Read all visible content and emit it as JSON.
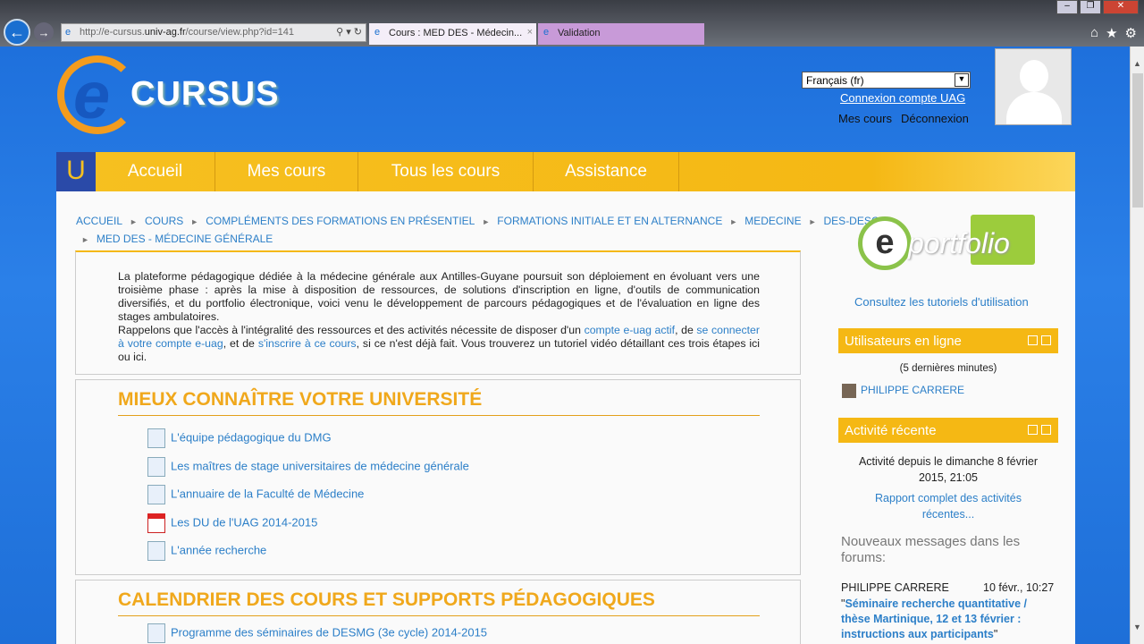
{
  "browser": {
    "url_prefix": "http://e-cursus.",
    "url_domain": "univ-ag.fr",
    "url_path": "/course/view.php?id=141",
    "tabs": [
      {
        "label": "Cours : MED DES - Médecin...",
        "active": true
      },
      {
        "label": "Validation",
        "active": false
      }
    ]
  },
  "header": {
    "logo_text": "CURSUS",
    "language": "Français (fr)",
    "login_link": "Connexion compte UAG",
    "my_courses": "Mes cours",
    "logout": "Déconnexion"
  },
  "menu": {
    "home": "Accueil",
    "mes_cours": "Mes cours",
    "tous": "Tous les cours",
    "assistance": "Assistance"
  },
  "breadcrumb": [
    "ACCUEIL",
    "COURS",
    "COMPLÉMENTS DES FORMATIONS EN PRÉSENTIEL",
    "FORMATIONS INITIALE ET EN ALTERNANCE",
    "MEDECINE",
    "DES-DESC",
    "MED DES - MÉDECINE GÉNÉRALE"
  ],
  "intro": {
    "p1": "La plateforme pédagogique dédiée à la médecine générale aux Antilles-Guyane poursuit son déploiement en évoluant vers une troisième phase : après la mise à disposition de ressources, de solutions d'inscription en ligne, d'outils de communication diversifiés, et du portfolio électronique,  voici venu le développement de parcours pédagogiques et de l'évaluation en ligne des stages ambulatoires.",
    "p2a": "Rappelons que l'accès à l'intégralité des ressources et des activités nécessite de disposer d'un ",
    "link1": "compte e-uag actif",
    "p2b": ", de ",
    "link2": "se connecter à votre compte e-uag",
    "p2c": ", et de ",
    "link3": "s'inscrire à ce cours",
    "p2d": ", si ce n'est déjà fait. Vous trouverez un tutoriel vidéo détaillant ces trois étapes ici ou ici."
  },
  "sections": [
    {
      "title": "MIEUX CONNAÎTRE VOTRE UNIVERSITÉ",
      "items": [
        {
          "label": "L'équipe pédagogique du DMG",
          "icon": "page-icon"
        },
        {
          "label": "Les maîtres de stage universitaires de médecine générale",
          "icon": "page-icon"
        },
        {
          "label": "L'annuaire de la Faculté de Médecine",
          "icon": "page-icon"
        },
        {
          "label": "Les DU de l'UAG 2014-2015",
          "icon": "pdf-icon"
        },
        {
          "label": "L'année recherche",
          "icon": "page-icon"
        }
      ]
    },
    {
      "title": "CALENDRIER DES COURS ET SUPPORTS PÉDAGOGIQUES",
      "items": [
        {
          "label": "Programme des séminaires de DESMG (3e cycle) 2014-2015",
          "icon": "page-icon"
        }
      ]
    }
  ],
  "sidebar": {
    "eportfolio": "portfolio",
    "tutorials": "Consultez les tutoriels d'utilisation",
    "online": {
      "title": "Utilisateurs en ligne",
      "period": "(5 dernières minutes)",
      "user": "PHILIPPE CARRERE"
    },
    "recent": {
      "title": "Activité récente",
      "since": "Activité depuis le dimanche 8 février 2015, 21:05",
      "report": "Rapport complet des activités récentes...",
      "forum_heading": "Nouveaux messages dans les forums:",
      "author": "PHILIPPE CARRERE",
      "date": "10 févr., 10:27",
      "post": "Séminaire recherche quantitative / thèse Martinique, 12 et 13 février : instructions aux participants"
    }
  }
}
